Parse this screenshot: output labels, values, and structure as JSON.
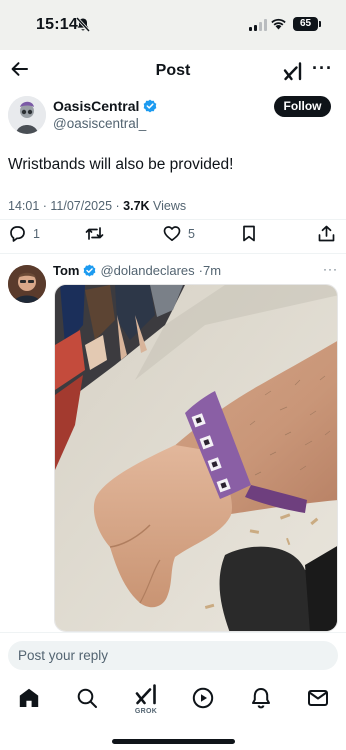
{
  "status_bar": {
    "time": "15:14",
    "battery": "65",
    "icons": [
      "bell-off-icon",
      "signal-icon",
      "wifi-icon",
      "battery-icon"
    ]
  },
  "header": {
    "title": "Post",
    "icons": [
      "back-arrow-icon",
      "grok-icon",
      "more-icon"
    ]
  },
  "post": {
    "author_name": "OasisCentral",
    "author_handle": "@oasiscentral_",
    "follow_label": "Follow",
    "text": "Wristbands will also be provided!",
    "timestamp": "14:01 · 11/07/2025 · ",
    "views_count": "3.7K",
    "views_label": " Views",
    "actions": {
      "replies": "1",
      "retweets": "",
      "likes": "5"
    }
  },
  "reply": {
    "name": "Tom",
    "handle": "@dolandeclares",
    "age": "·7m",
    "more": "···"
  },
  "composer": {
    "placeholder": "Post your reply"
  },
  "tabbar": {
    "grok_label": "GROK",
    "icons": [
      "home-icon",
      "search-icon",
      "grok-icon",
      "play-icon",
      "notifications-icon",
      "messages-icon"
    ]
  },
  "colors": {
    "text": "#0f1419",
    "secondary": "#536471",
    "verified": "#1d9bf0",
    "status_bar_bg": "#f0f1ee"
  }
}
